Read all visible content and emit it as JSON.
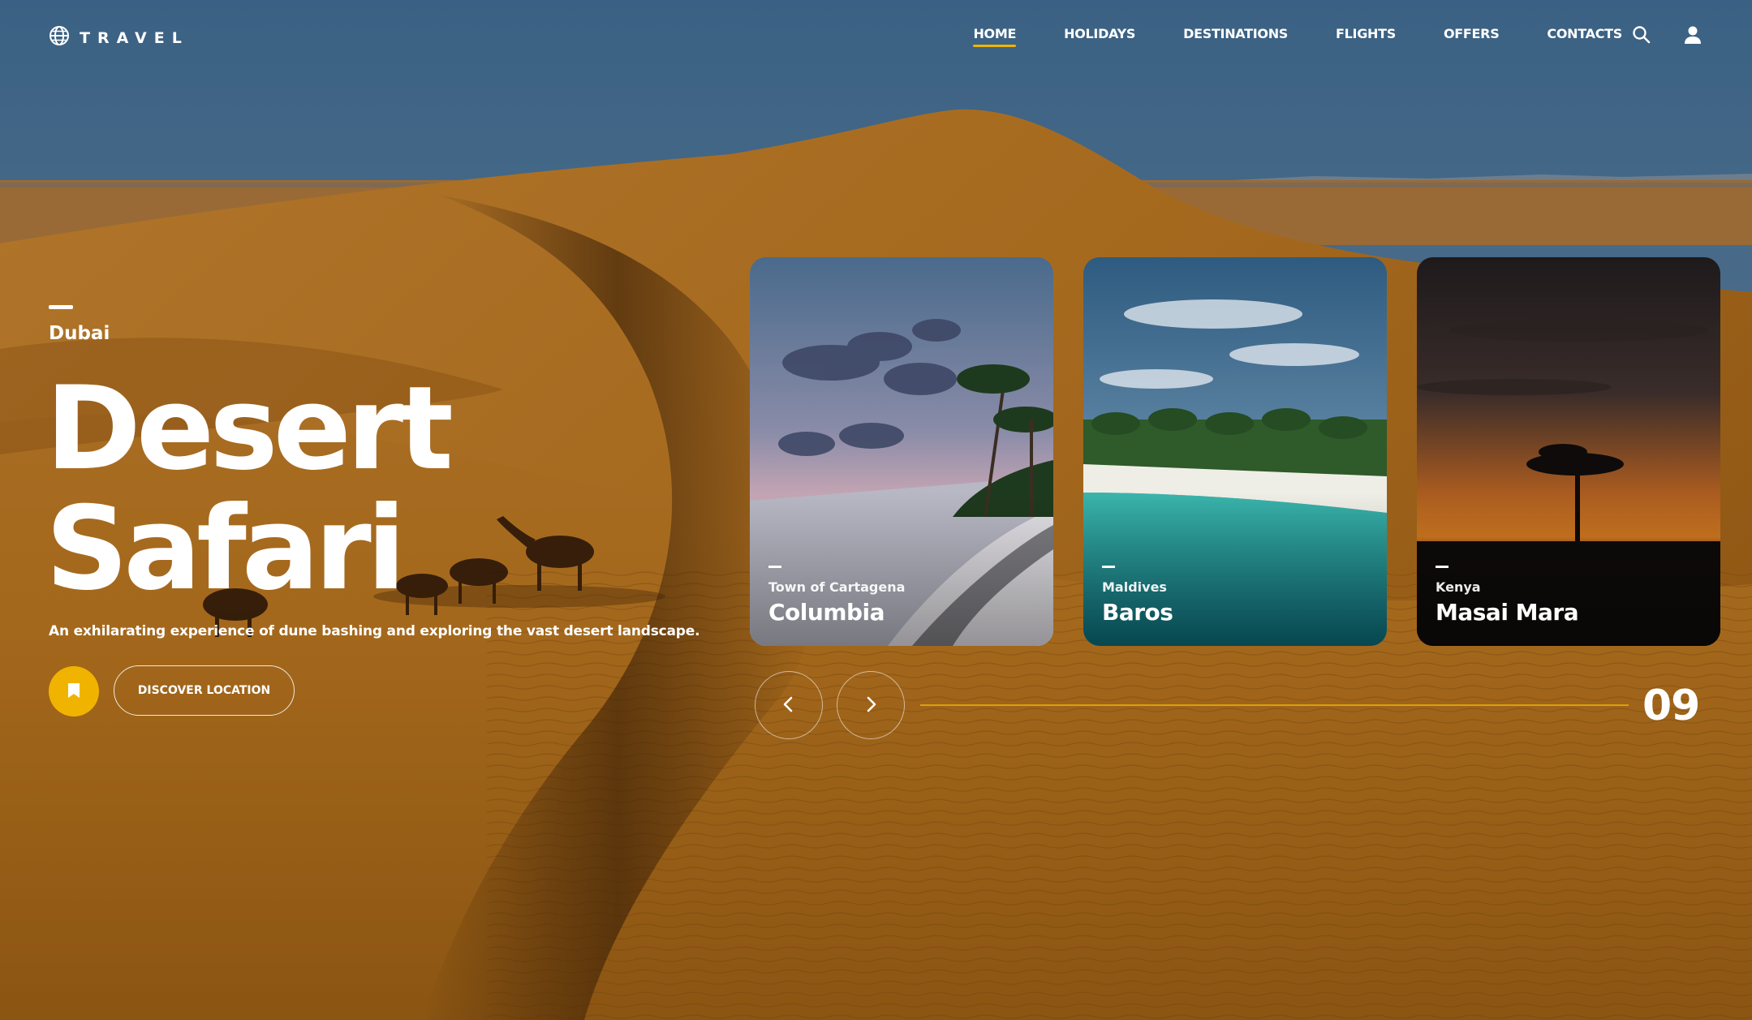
{
  "brand": {
    "name": "TRAVEL",
    "icon": "globe-icon"
  },
  "nav": {
    "items": [
      {
        "label": "HOME",
        "active": true
      },
      {
        "label": "HOLIDAYS",
        "active": false
      },
      {
        "label": "DESTINATIONS",
        "active": false
      },
      {
        "label": "FLIGHTS",
        "active": false
      },
      {
        "label": "OFFERS",
        "active": false
      },
      {
        "label": "CONTACTS",
        "active": false
      }
    ],
    "icons": [
      "search-icon",
      "user-icon"
    ]
  },
  "hero": {
    "location": "Dubai",
    "title_line1": "Desert",
    "title_line2": "Safari",
    "subtitle": "An exhilarating experience of dune bashing and exploring the vast desert landscape.",
    "bookmark_icon": "bookmark-icon",
    "cta_label": "DISCOVER LOCATION"
  },
  "cards": [
    {
      "subtitle": "Town of Cartagena",
      "title": "Columbia"
    },
    {
      "subtitle": "Maldives",
      "title": "Baros"
    },
    {
      "subtitle": "Kenya",
      "title": "Masai Mara"
    }
  ],
  "slider": {
    "prev_icon": "chevron-left-icon",
    "next_icon": "chevron-right-icon",
    "current": "09"
  },
  "colors": {
    "accent": "#f0b400",
    "sky": "#3f6585",
    "sand": "#9a5e18",
    "text": "#ffffff"
  }
}
